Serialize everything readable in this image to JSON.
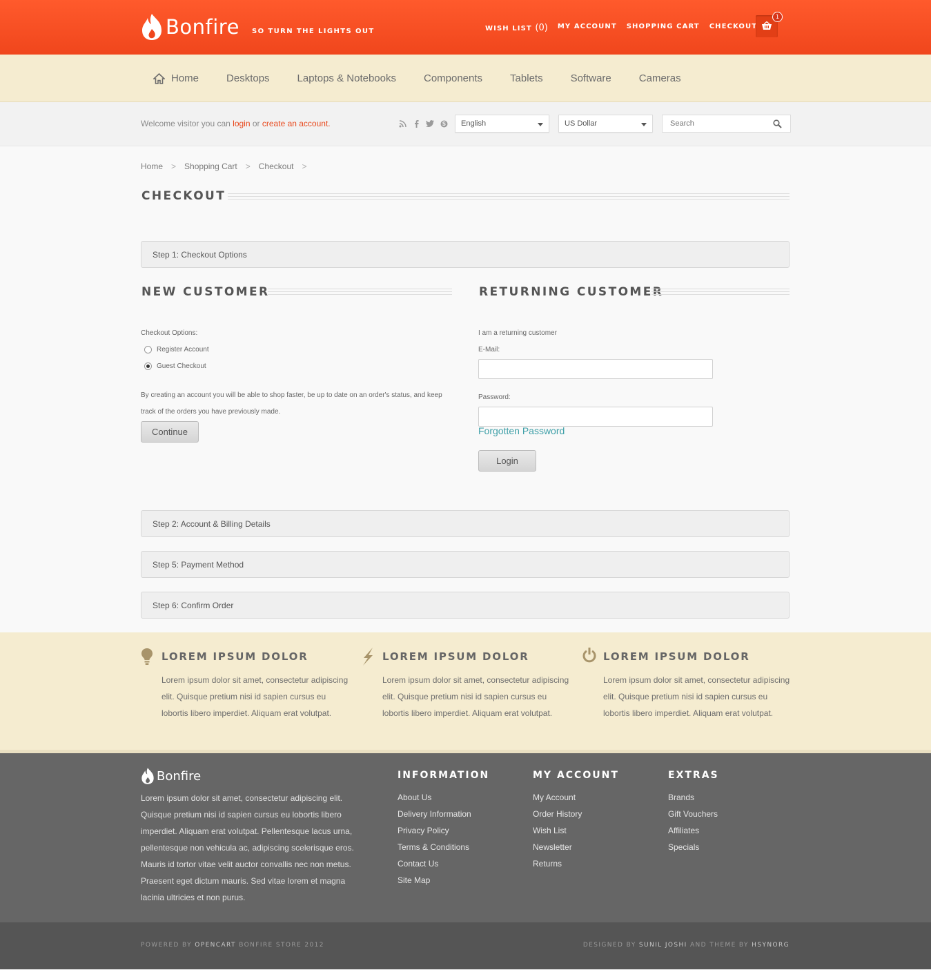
{
  "header": {
    "brand": "Bonfire",
    "tagline": "SO TURN THE LIGHTS OUT",
    "links": {
      "wishlist_label": "WISH LIST",
      "wishlist_count": "(0)",
      "account": "MY ACCOUNT",
      "cart": "SHOPPING CART",
      "checkout": "CHECKOUT"
    },
    "cart_count": "1"
  },
  "nav": {
    "items": [
      "Home",
      "Desktops",
      "Laptops & Notebooks",
      "Components",
      "Tablets",
      "Software",
      "Cameras"
    ]
  },
  "subbar": {
    "welcome_prefix": "Welcome visitor you can",
    "login": "login",
    "or": "or",
    "create": "create an account",
    "welcome_suffix": ".",
    "language": "English",
    "currency": "US Dollar",
    "search_placeholder": "Search"
  },
  "breadcrumb": [
    "Home",
    "Shopping Cart",
    "Checkout"
  ],
  "page_title": "CHECKOUT",
  "steps": {
    "step1": "Step 1: Checkout Options",
    "step2": "Step 2: Account & Billing Details",
    "step5": "Step 5: Payment Method",
    "step6": "Step 6: Confirm Order"
  },
  "new_customer": {
    "heading": "NEW CUSTOMER",
    "options_label": "Checkout Options:",
    "register": "Register Account",
    "guest": "Guest Checkout",
    "description": "By creating an account you will be able to shop faster, be up to date on an order's status, and keep track of the orders you have previously made.",
    "continue": "Continue"
  },
  "returning_customer": {
    "heading": "RETURNING CUSTOMER",
    "intro": "I am a returning customer",
    "email_label": "E-Mail:",
    "password_label": "Password:",
    "forgot": "Forgotten Password",
    "login": "Login"
  },
  "features": [
    {
      "icon": "lightbulb-icon",
      "title": "LOREM IPSUM DOLOR",
      "text": "Lorem ipsum dolor sit amet, consectetur adipiscing elit. Quisque pretium nisi id sapien cursus eu lobortis libero imperdiet. Aliquam erat volutpat."
    },
    {
      "icon": "bolt-icon",
      "title": "LOREM IPSUM DOLOR",
      "text": "Lorem ipsum dolor sit amet, consectetur adipiscing elit. Quisque pretium nisi id sapien cursus eu lobortis libero imperdiet. Aliquam erat volutpat."
    },
    {
      "icon": "power-icon",
      "title": "LOREM IPSUM DOLOR",
      "text": "Lorem ipsum dolor sit amet, consectetur adipiscing elit. Quisque pretium nisi id sapien cursus eu lobortis libero imperdiet. Aliquam erat volutpat."
    }
  ],
  "footer": {
    "brand": "Bonfire",
    "about": "Lorem ipsum dolor sit amet, consectetur adipiscing elit. Quisque pretium nisi id sapien cursus eu lobortis libero imperdiet. Aliquam erat volutpat. Pellentesque lacus urna, pellentesque non vehicula ac, adipiscing scelerisque eros. Mauris id tortor vitae velit auctor convallis nec non metus. Praesent eget dictum mauris. Sed vitae lorem et magna lacinia ultricies et non purus.",
    "information": {
      "title": "INFORMATION",
      "items": [
        "About Us",
        "Delivery Information",
        "Privacy Policy",
        "Terms & Conditions",
        "Contact Us",
        "Site Map"
      ]
    },
    "account": {
      "title": "MY ACCOUNT",
      "items": [
        "My Account",
        "Order History",
        "Wish List",
        "Newsletter",
        "Returns"
      ]
    },
    "extras": {
      "title": "EXTRAS",
      "items": [
        "Brands",
        "Gift Vouchers",
        "Affiliates",
        "Specials"
      ]
    },
    "copyright_prefix": "POWERED BY",
    "copyright_brand": "OPENCART",
    "copyright_suffix": "BONFIRE STORE 2012",
    "designed_prefix": "DESIGNED BY",
    "designer": "SUNIL JOSHI",
    "designed_mid": "AND THEME BY",
    "theme_by": "HSYNORG"
  },
  "colors": {
    "brand_orange": "#f0461c",
    "cream": "#f5ecd0",
    "link_teal": "#3fa0a8",
    "footer_gray": "#666666"
  }
}
